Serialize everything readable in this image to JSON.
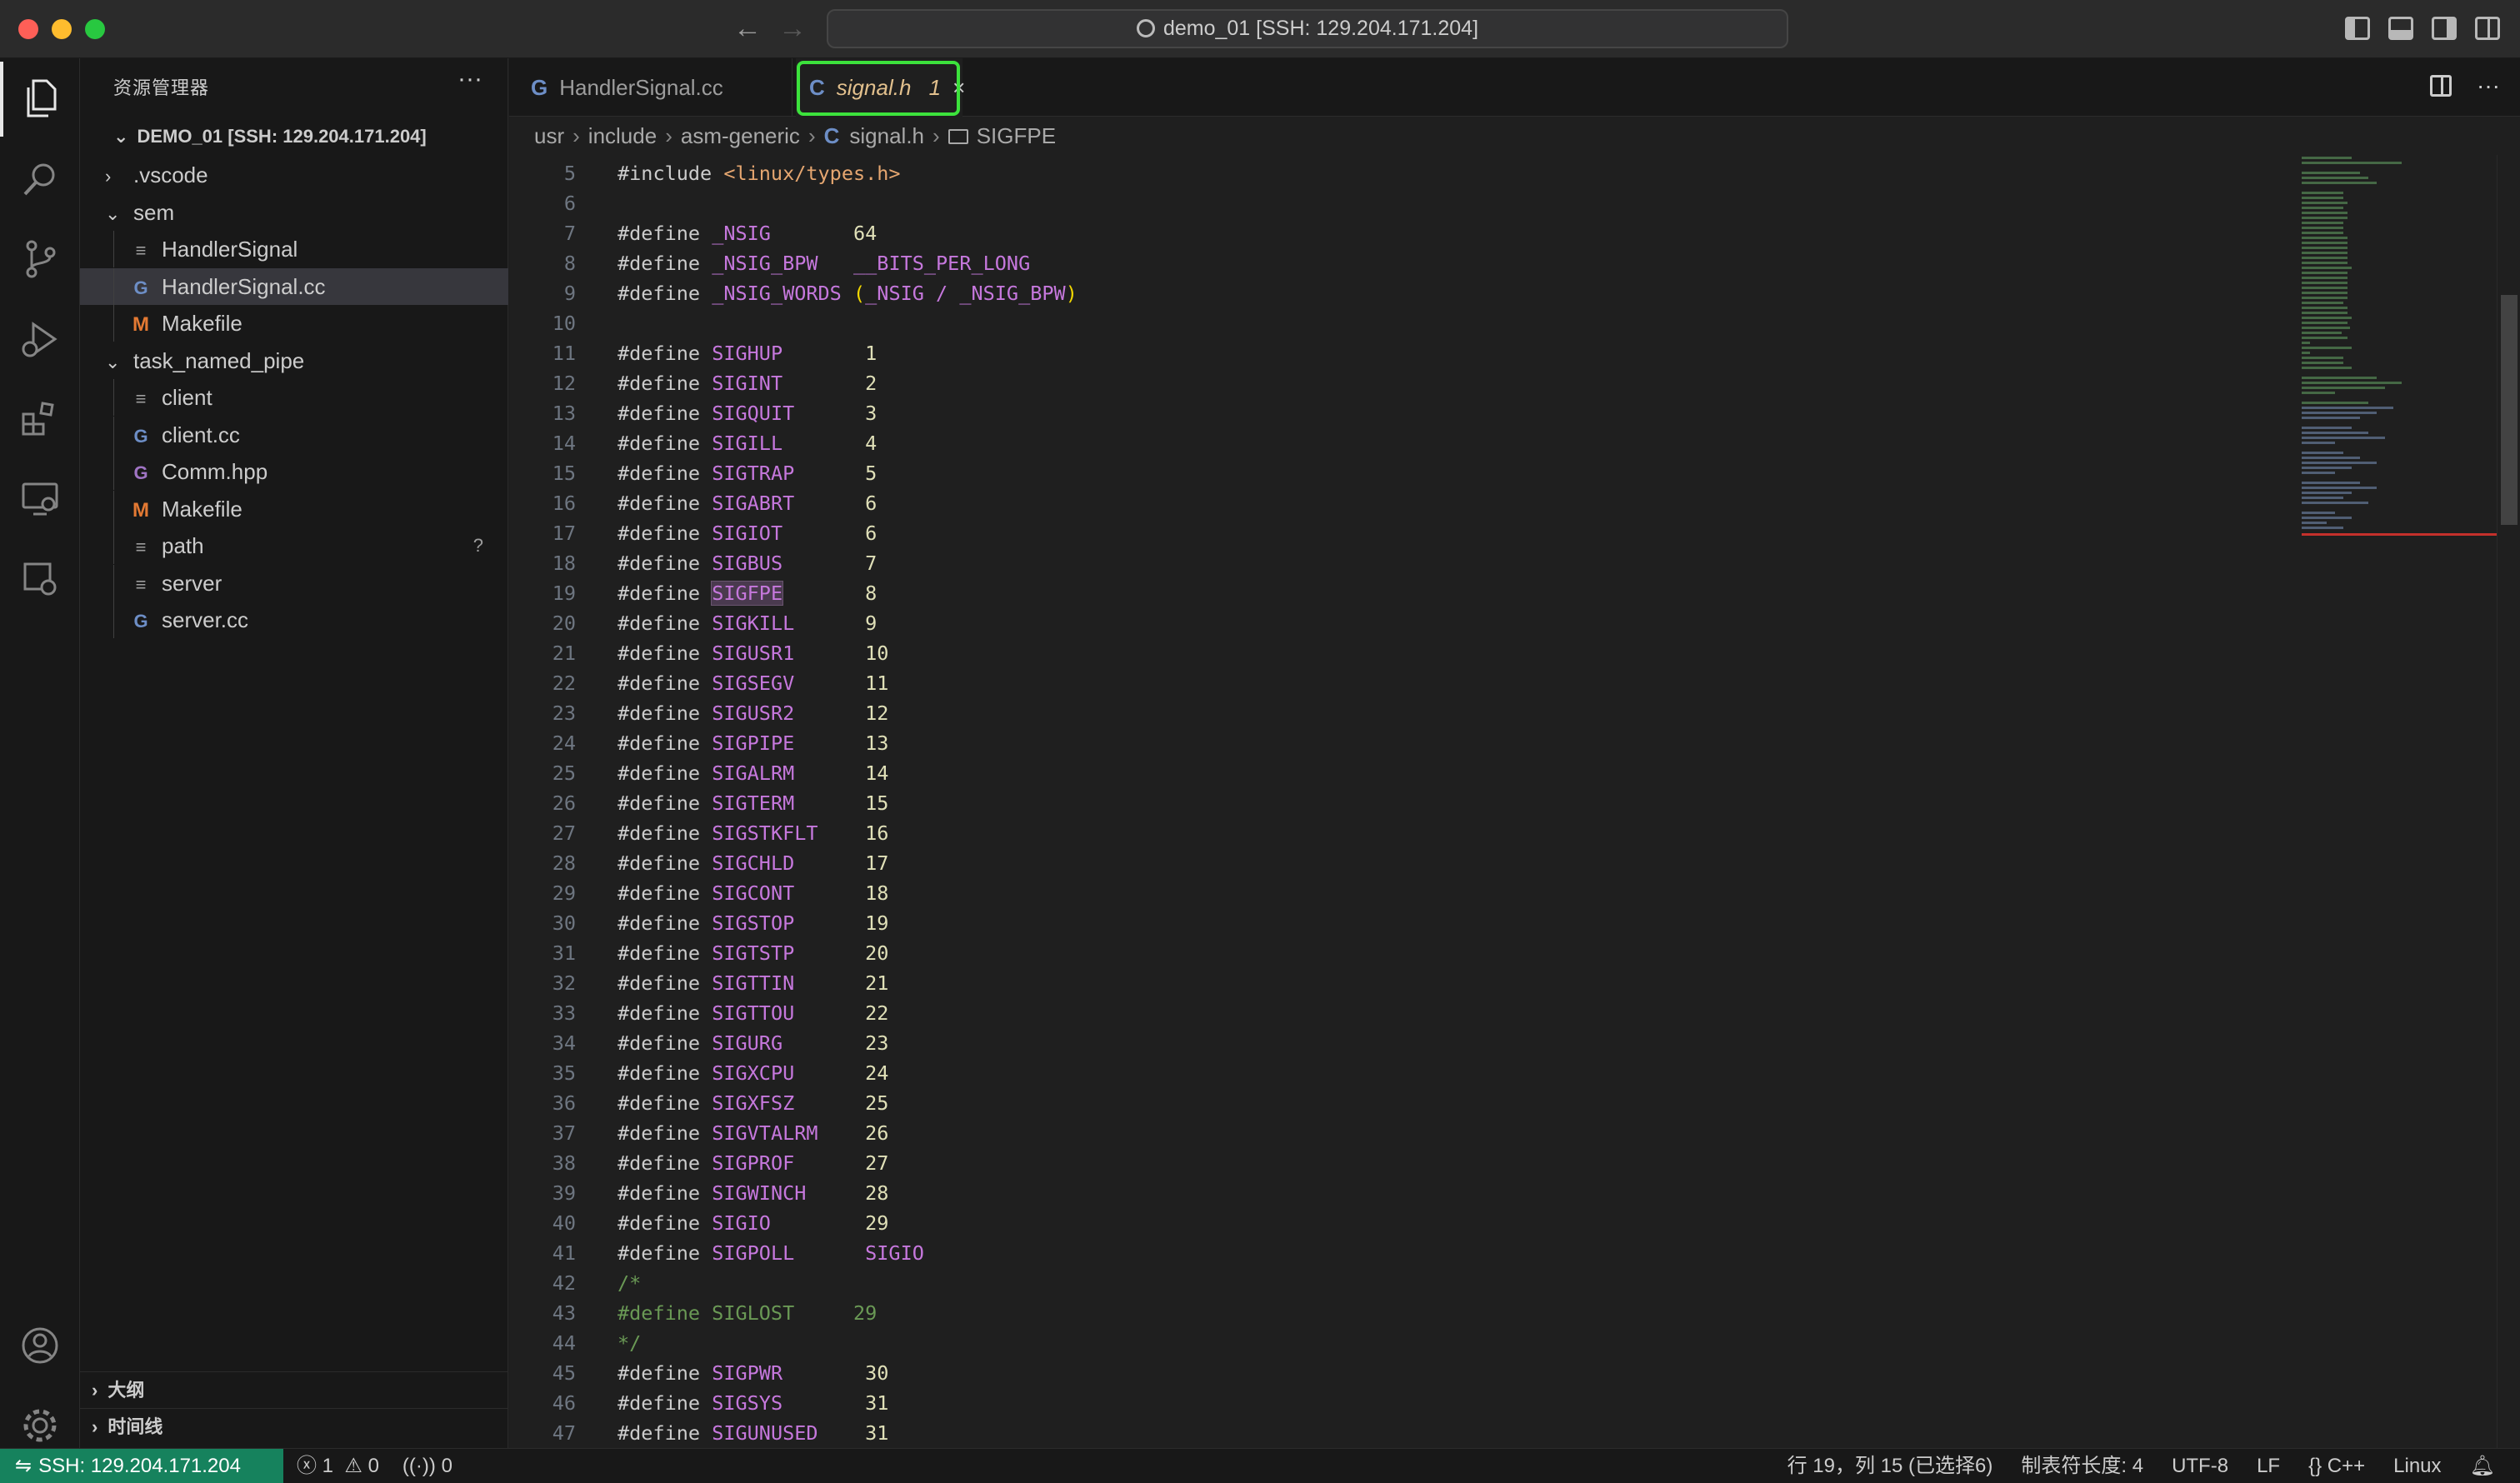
{
  "titlebar": {
    "command_center": "demo_01 [SSH: 129.204.171.204]"
  },
  "sidebar": {
    "title": "资源管理器",
    "root": "DEMO_01 [SSH: 129.204.171.204]",
    "tree": [
      {
        "label": ".vscode",
        "type": "folder",
        "expanded": false,
        "depth": 1
      },
      {
        "label": "sem",
        "type": "folder",
        "expanded": true,
        "depth": 1
      },
      {
        "label": "HandlerSignal",
        "type": "file-text",
        "depth": 2
      },
      {
        "label": "HandlerSignal.cc",
        "type": "file-c",
        "depth": 2,
        "selected": true
      },
      {
        "label": "Makefile",
        "type": "file-make",
        "depth": 2
      },
      {
        "label": "task_named_pipe",
        "type": "folder",
        "expanded": true,
        "depth": 1
      },
      {
        "label": "client",
        "type": "file-text",
        "depth": 2
      },
      {
        "label": "client.cc",
        "type": "file-c",
        "depth": 2
      },
      {
        "label": "Comm.hpp",
        "type": "file-hpp",
        "depth": 2
      },
      {
        "label": "Makefile",
        "type": "file-make",
        "depth": 2
      },
      {
        "label": "path",
        "type": "file-text",
        "depth": 2,
        "badge": "?"
      },
      {
        "label": "server",
        "type": "file-text",
        "depth": 2
      },
      {
        "label": "server.cc",
        "type": "file-c",
        "depth": 2
      }
    ],
    "outline_label": "大纲",
    "timeline_label": "时间线"
  },
  "tabs": [
    {
      "label": "HandlerSignal.cc",
      "active": false
    },
    {
      "label": "signal.h",
      "active": true,
      "problems": "1"
    }
  ],
  "breadcrumb": {
    "parts": [
      "usr",
      "include",
      "asm-generic",
      "signal.h",
      "SIGFPE"
    ]
  },
  "editor": {
    "lines": [
      {
        "n": "5",
        "kind": "include",
        "directive": "#include",
        "arg": "<linux/types.h>"
      },
      {
        "n": "6",
        "kind": "blank"
      },
      {
        "n": "7",
        "kind": "define",
        "name": "_NSIG",
        "pad": "       ",
        "value": "64",
        "vtype": "num"
      },
      {
        "n": "8",
        "kind": "define",
        "name": "_NSIG_BPW",
        "pad": "   ",
        "value": "__BITS_PER_LONG",
        "vtype": "mac"
      },
      {
        "n": "9",
        "kind": "define_expr",
        "name": "_NSIG_WORDS",
        "pad": " ",
        "value": "(_NSIG / _NSIG_BPW)"
      },
      {
        "n": "10",
        "kind": "blank"
      },
      {
        "n": "11",
        "kind": "define",
        "name": "SIGHUP",
        "pad": "       ",
        "value": "1",
        "vtype": "num"
      },
      {
        "n": "12",
        "kind": "define",
        "name": "SIGINT",
        "pad": "       ",
        "value": "2",
        "vtype": "num"
      },
      {
        "n": "13",
        "kind": "define",
        "name": "SIGQUIT",
        "pad": "      ",
        "value": "3",
        "vtype": "num"
      },
      {
        "n": "14",
        "kind": "define",
        "name": "SIGILL",
        "pad": "       ",
        "value": "4",
        "vtype": "num"
      },
      {
        "n": "15",
        "kind": "define",
        "name": "SIGTRAP",
        "pad": "      ",
        "value": "5",
        "vtype": "num"
      },
      {
        "n": "16",
        "kind": "define",
        "name": "SIGABRT",
        "pad": "      ",
        "value": "6",
        "vtype": "num"
      },
      {
        "n": "17",
        "kind": "define",
        "name": "SIGIOT",
        "pad": "       ",
        "value": "6",
        "vtype": "num"
      },
      {
        "n": "18",
        "kind": "define",
        "name": "SIGBUS",
        "pad": "       ",
        "value": "7",
        "vtype": "num"
      },
      {
        "n": "19",
        "kind": "define",
        "name": "SIGFPE",
        "pad": "       ",
        "value": "8",
        "vtype": "num",
        "highlight": true
      },
      {
        "n": "20",
        "kind": "define",
        "name": "SIGKILL",
        "pad": "      ",
        "value": "9",
        "vtype": "num"
      },
      {
        "n": "21",
        "kind": "define",
        "name": "SIGUSR1",
        "pad": "      ",
        "value": "10",
        "vtype": "num"
      },
      {
        "n": "22",
        "kind": "define",
        "name": "SIGSEGV",
        "pad": "      ",
        "value": "11",
        "vtype": "num"
      },
      {
        "n": "23",
        "kind": "define",
        "name": "SIGUSR2",
        "pad": "      ",
        "value": "12",
        "vtype": "num"
      },
      {
        "n": "24",
        "kind": "define",
        "name": "SIGPIPE",
        "pad": "      ",
        "value": "13",
        "vtype": "num"
      },
      {
        "n": "25",
        "kind": "define",
        "name": "SIGALRM",
        "pad": "      ",
        "value": "14",
        "vtype": "num"
      },
      {
        "n": "26",
        "kind": "define",
        "name": "SIGTERM",
        "pad": "      ",
        "value": "15",
        "vtype": "num"
      },
      {
        "n": "27",
        "kind": "define",
        "name": "SIGSTKFLT",
        "pad": "    ",
        "value": "16",
        "vtype": "num"
      },
      {
        "n": "28",
        "kind": "define",
        "name": "SIGCHLD",
        "pad": "      ",
        "value": "17",
        "vtype": "num"
      },
      {
        "n": "29",
        "kind": "define",
        "name": "SIGCONT",
        "pad": "      ",
        "value": "18",
        "vtype": "num"
      },
      {
        "n": "30",
        "kind": "define",
        "name": "SIGSTOP",
        "pad": "      ",
        "value": "19",
        "vtype": "num"
      },
      {
        "n": "31",
        "kind": "define",
        "name": "SIGTSTP",
        "pad": "      ",
        "value": "20",
        "vtype": "num"
      },
      {
        "n": "32",
        "kind": "define",
        "name": "SIGTTIN",
        "pad": "      ",
        "value": "21",
        "vtype": "num"
      },
      {
        "n": "33",
        "kind": "define",
        "name": "SIGTTOU",
        "pad": "      ",
        "value": "22",
        "vtype": "num"
      },
      {
        "n": "34",
        "kind": "define",
        "name": "SIGURG",
        "pad": "       ",
        "value": "23",
        "vtype": "num"
      },
      {
        "n": "35",
        "kind": "define",
        "name": "SIGXCPU",
        "pad": "      ",
        "value": "24",
        "vtype": "num"
      },
      {
        "n": "36",
        "kind": "define",
        "name": "SIGXFSZ",
        "pad": "      ",
        "value": "25",
        "vtype": "num"
      },
      {
        "n": "37",
        "kind": "define",
        "name": "SIGVTALRM",
        "pad": "    ",
        "value": "26",
        "vtype": "num"
      },
      {
        "n": "38",
        "kind": "define",
        "name": "SIGPROF",
        "pad": "      ",
        "value": "27",
        "vtype": "num"
      },
      {
        "n": "39",
        "kind": "define",
        "name": "SIGWINCH",
        "pad": "     ",
        "value": "28",
        "vtype": "num"
      },
      {
        "n": "40",
        "kind": "define",
        "name": "SIGIO",
        "pad": "        ",
        "value": "29",
        "vtype": "num"
      },
      {
        "n": "41",
        "kind": "define",
        "name": "SIGPOLL",
        "pad": "      ",
        "value": "SIGIO",
        "vtype": "mac"
      },
      {
        "n": "42",
        "kind": "comment",
        "text": "/*"
      },
      {
        "n": "43",
        "kind": "comment",
        "text": "#define SIGLOST     29"
      },
      {
        "n": "44",
        "kind": "comment",
        "text": "*/"
      },
      {
        "n": "45",
        "kind": "define",
        "name": "SIGPWR",
        "pad": "       ",
        "value": "30",
        "vtype": "num"
      },
      {
        "n": "46",
        "kind": "define",
        "name": "SIGSYS",
        "pad": "       ",
        "value": "31",
        "vtype": "num"
      },
      {
        "n": "47",
        "kind": "define",
        "name": "SIGUNUSED",
        "pad": "    ",
        "value": "31",
        "vtype": "num"
      }
    ]
  },
  "statusbar": {
    "remote": "SSH: 129.204.171.204",
    "errors": "1",
    "warnings": "0",
    "ports": "0",
    "cursor": "行 19，列 15 (已选择6)",
    "tab_size": "制表符长度: 4",
    "encoding": "UTF-8",
    "eol": "LF",
    "language": "C++",
    "platform": "Linux"
  },
  "colors": {
    "accent_remote": "#16825d",
    "tab_outline": "#3ce23c",
    "macro": "#c678dd"
  }
}
